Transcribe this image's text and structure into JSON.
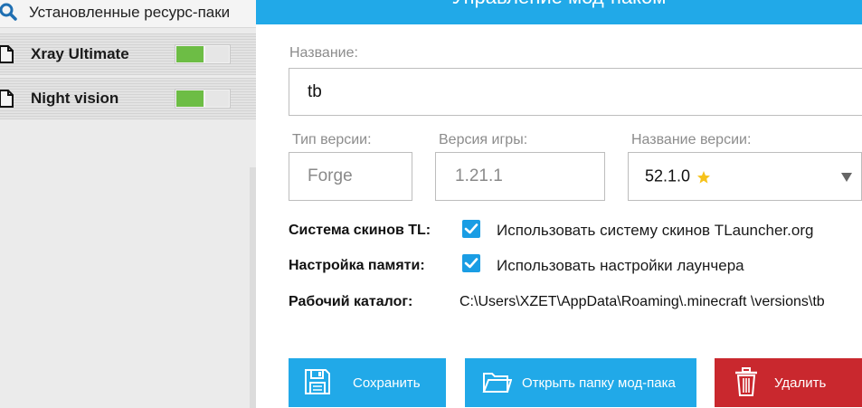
{
  "sidebar": {
    "title": "Установленные ресурс-паки",
    "packs": [
      {
        "name": "Xray Ultimate",
        "enabled": true
      },
      {
        "name": "Night vision",
        "enabled": true
      }
    ]
  },
  "panel": {
    "title": "Управление мод-паком",
    "name_label": "Название:",
    "name_value": "tb",
    "version_type_label": "Тип версии:",
    "version_type_value": "Forge",
    "game_version_label": "Версия игры:",
    "game_version_value": "1.21.1",
    "version_name_label": "Название версии:",
    "version_name_value": "52.1.0",
    "skins_label": "Система скинов TL:",
    "skins_checkbox": "Использовать систему скинов TLauncher.org",
    "skins_checked": true,
    "memory_label": "Настройка памяти:",
    "memory_checkbox": "Использовать настройки лаунчера",
    "memory_checked": true,
    "dir_label": "Рабочий каталог:",
    "dir_value": "C:\\Users\\XZET\\AppData\\Roaming\\.minecraft \\versions\\tb"
  },
  "buttons": {
    "save": "Сохранить",
    "open_folder": "Открыть папку мод-пака",
    "delete": "Удалить"
  },
  "colors": {
    "accent": "#21a9e8",
    "checkbox": "#1a9de4",
    "toggle_on": "#6dbd45",
    "danger": "#c9282e"
  },
  "icons": {
    "search": "search-icon",
    "file": "file-icon",
    "star": "star-icon",
    "dropdown": "chevron-down-icon",
    "check": "check-icon",
    "save": "floppy-disk-icon",
    "folder": "folder-icon",
    "trash": "trash-icon"
  }
}
